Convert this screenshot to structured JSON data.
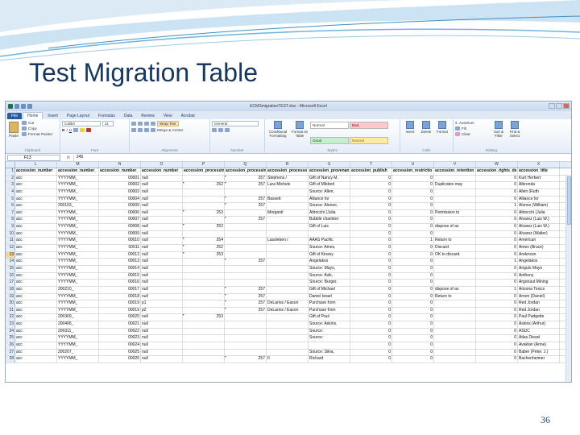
{
  "slide": {
    "title": "Test Migration Table",
    "page_number": "36"
  },
  "window": {
    "title": "ECMSmigrationTEST.xlsx - Microsoft Excel"
  },
  "tabs": [
    "File",
    "Home",
    "Insert",
    "Page Layout",
    "Formulas",
    "Data",
    "Review",
    "View",
    "Acrobat"
  ],
  "ribbon": {
    "clipboard": {
      "paste": "Paste",
      "cut": "Cut",
      "copy": "Copy",
      "painter": "Format Painter",
      "label": "Clipboard"
    },
    "font": {
      "name": "Calibri",
      "size": "11",
      "label": "Font"
    },
    "alignment": {
      "wrap": "Wrap Text",
      "merge": "Merge & Center",
      "label": "Alignment"
    },
    "number": {
      "format": "General",
      "label": "Number"
    },
    "styles": {
      "conditional": "Conditional Formatting",
      "format_table": "Format as Table",
      "normal": "Normal",
      "bad": "Bad",
      "good": "Good",
      "neutral": "Neutral",
      "label": "Styles"
    },
    "cells": {
      "insert": "Insert",
      "delete": "Delete",
      "format": "Format",
      "label": "Cells"
    },
    "editing": {
      "autosum": "AutoSum",
      "fill": "Fill",
      "clear": "Clear",
      "sort": "Sort & Filter",
      "find": "Find & Select",
      "label": "Editing"
    }
  },
  "formula_bar": {
    "cell": "F13",
    "fx": "fx",
    "value": "245"
  },
  "columns": [
    "L",
    "M",
    "N",
    "O",
    "P",
    "Q",
    "R",
    "S",
    "T",
    "U",
    "V",
    "W",
    "X"
  ],
  "selected_row": 13,
  "rows": [
    [
      "1",
      "accession_number",
      "accession_number_",
      "accession_number_",
      "accession_number_",
      "accession_processin",
      "accession_processin",
      "accession_processo",
      "accession_provenan",
      "accession_publish",
      "accession_restrictio",
      "accession_retention",
      "accession_rights_de",
      "accession_title"
    ],
    [
      "2",
      "acc",
      "YYYYMM_",
      "00001",
      "null",
      "",
      "257",
      "Stephens /",
      "Gift of Nancy M.",
      "0",
      "0",
      "",
      "0",
      "Kurt Herbert"
    ],
    [
      "3",
      "acc",
      "YYYYMM_",
      "00002",
      "null",
      "252",
      "257",
      "Lara Michels",
      "Gift of Mildred",
      "0",
      "0",
      "Duplicates may",
      "0",
      "Albronda"
    ],
    [
      "4",
      "acc",
      "YYYYMM_",
      "00003",
      "null",
      "",
      "",
      "",
      "Source: Allen,",
      "0",
      "0",
      "",
      "0",
      "Allen (Ruth"
    ],
    [
      "5",
      "acc",
      "YYYYMM_",
      "00004",
      "null",
      "",
      "257",
      "Bassett",
      "Alliance for",
      "0",
      "0",
      "",
      "0",
      "Alliance for"
    ],
    [
      "6",
      "acc",
      "200103_",
      "00005",
      "null",
      "",
      "257",
      "",
      "Source: Alonso,",
      "0",
      "0",
      "",
      "1",
      "Alonso (William)"
    ],
    [
      "7",
      "acc",
      "YYYYMM_",
      "00006",
      "null",
      "253",
      "",
      "Morganti",
      "Altrocchi (Julia",
      "0",
      "0",
      "Permission to",
      "0",
      "Altrocchi (Julia"
    ],
    [
      "8",
      "acc",
      "YYYYMM_",
      "00007",
      "null",
      "",
      "257",
      "",
      "Bubble chamber",
      "0",
      "0",
      "",
      "0",
      "Alvarez (Luis W.)"
    ],
    [
      "9",
      "acc",
      "YYYYMM_",
      "00008",
      "null",
      "252",
      "",
      "",
      "Gift of Luis",
      "0",
      "0",
      "dispose of as",
      "0",
      "Alvarez (Luis W.)"
    ],
    [
      "10",
      "acc",
      "YYYYMM_",
      "00009",
      "null",
      "",
      "",
      "",
      "",
      "0",
      "0",
      "",
      "0",
      "Alvarez (Walter)"
    ],
    [
      "11",
      "acc",
      "YYYYMM_",
      "00010",
      "null",
      "254",
      "",
      "Lassleben /",
      "AAAS Pacific",
      "0",
      "1",
      "Return to",
      "0",
      "American"
    ],
    [
      "12",
      "acc",
      "YYYYMM_",
      "00011",
      "null",
      "252",
      "",
      "",
      "Source: Ames,",
      "0",
      "0",
      "Discard",
      "0",
      "Ames (Bruce)"
    ],
    [
      "13",
      "acc",
      "YYYYMM_",
      "00012",
      "null",
      "253",
      "",
      "",
      "Gift of Kinsey",
      "0",
      "0",
      "OK to discard.",
      "0",
      "Anderson"
    ],
    [
      "14",
      "acc",
      "YYYYMM_",
      "00013",
      "null",
      "",
      "257",
      "",
      "Angelakos",
      "0",
      "0",
      "",
      "1",
      "Angelakos"
    ],
    [
      "15",
      "acc",
      "YYYYMM_",
      "00014",
      "null",
      "",
      "",
      "",
      "Source: Mayo,",
      "0",
      "0",
      "",
      "0",
      "Angulo Mayo"
    ],
    [
      "16",
      "acc",
      "YYYYMM_",
      "00015",
      "null",
      "",
      "",
      "",
      "Source: Avik,",
      "0",
      "0",
      "",
      "0",
      "Anthony"
    ],
    [
      "17",
      "acc",
      "YYYYMM_",
      "00016",
      "null",
      "",
      "",
      "",
      "Source: Burger,",
      "0",
      "0",
      "",
      "0",
      "Argonaut Mining"
    ],
    [
      "18",
      "acc",
      "200210_",
      "00017",
      "null",
      "",
      "257",
      "",
      "Gift of Michael",
      "0",
      "0",
      "dispose of as",
      "1",
      "Arizona Toxics"
    ],
    [
      "19",
      "acc",
      "YYYYMM_",
      "00018",
      "null",
      "",
      "257",
      "",
      "Daniel Israel",
      "0",
      "0",
      "Return to",
      "0",
      "Arnon (Daniel)"
    ],
    [
      "20",
      "acc",
      "YYYYMM_",
      "00019",
      "p1",
      "",
      "257",
      "DeLarios / Eason",
      "Purchase from",
      "0",
      "0",
      "",
      "0",
      "Red Jordan"
    ],
    [
      "21",
      "acc",
      "YYYYMM_",
      "00019",
      "p2",
      "",
      "257",
      "DeLarios / Eason",
      "Purchase from",
      "0",
      "0",
      "",
      "0",
      "Red Jordan"
    ],
    [
      "22",
      "acc",
      "200309_",
      "00020",
      "null",
      "253",
      "",
      "",
      "Gift of Paul",
      "0",
      "0",
      "",
      "0",
      "Paul Padgette"
    ],
    [
      "23",
      "acc",
      "200406_",
      "00021",
      "null",
      "",
      "",
      "",
      "Source: Askins,",
      "0",
      "0",
      "",
      "0",
      "Askins (Arthur)"
    ],
    [
      "24",
      "acc",
      "200311_",
      "00022",
      "null",
      "",
      "",
      "",
      "Source:",
      "0",
      "0",
      "",
      "0",
      "ASUC"
    ],
    [
      "25",
      "acc",
      "YYYYMM_",
      "00023",
      "null",
      "",
      "",
      "",
      "Source:",
      "0",
      "0",
      "",
      "0",
      "Atlas Diesel"
    ],
    [
      "26",
      "acc",
      "YYYYMM_",
      "00024",
      "null",
      "",
      "",
      "",
      "",
      "0",
      "0",
      "",
      "0",
      "Avakian (Anne)"
    ],
    [
      "27",
      "acc",
      "200207_",
      "00025",
      "null",
      "",
      "",
      "",
      "Source: Silva,",
      "0",
      "0",
      "",
      "0",
      "Baber (Peter. J.)"
    ],
    [
      "28",
      "acc",
      "YYYYMM_",
      "00026",
      "null",
      "",
      "257",
      "II",
      "Richard",
      "0",
      "0",
      "",
      "0",
      "Bachenheimer"
    ]
  ]
}
